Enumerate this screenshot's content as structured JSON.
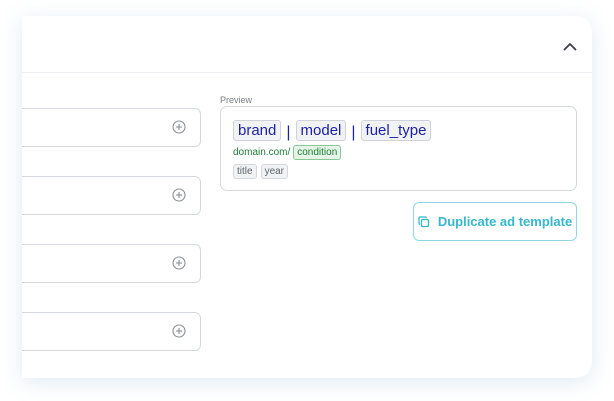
{
  "header": {
    "collapse_icon": "chevron-up-icon"
  },
  "fields": [
    {
      "add_icon": "plus-circle-icon"
    },
    {
      "add_icon": "plus-circle-icon"
    },
    {
      "add_icon": "plus-circle-icon"
    },
    {
      "add_icon": "plus-circle-icon"
    }
  ],
  "preview": {
    "label": "Preview",
    "headline_tokens": [
      "brand",
      "model",
      "fuel_type"
    ],
    "separator": "|",
    "domain": "domain.com/",
    "path_token": "condition",
    "description_tokens": [
      "title",
      "year"
    ]
  },
  "duplicate_button": {
    "label": "Duplicate ad template",
    "icon": "copy-icon"
  },
  "colors": {
    "accent": "#36b8cc",
    "token_text": "#1c22a8",
    "url_green": "#1e7e34"
  }
}
